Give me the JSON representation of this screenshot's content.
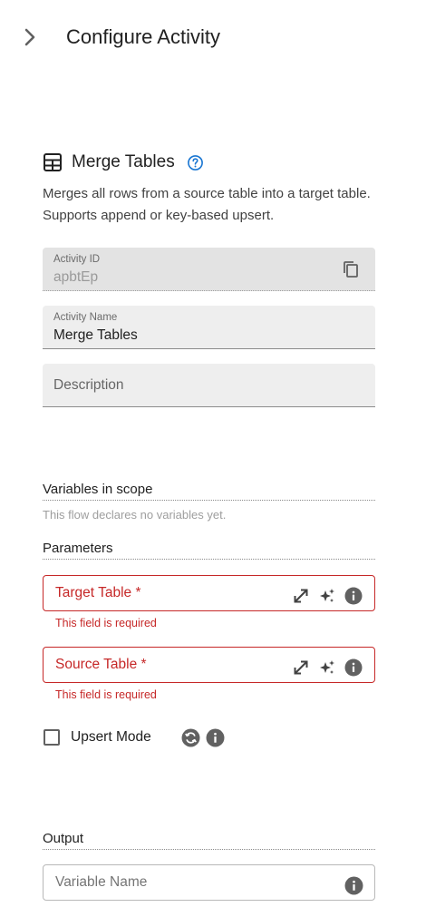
{
  "header": {
    "title": "Configure Activity"
  },
  "activity": {
    "title": "Merge Tables",
    "description": "Merges all rows from a source table into a target table. Supports append or key-based upsert."
  },
  "fields": {
    "activity_id": {
      "label": "Activity ID",
      "value": "apbtEp"
    },
    "activity_name": {
      "label": "Activity Name",
      "value": "Merge Tables"
    },
    "description": {
      "placeholder": "Description"
    }
  },
  "variables": {
    "title": "Variables in scope",
    "empty_note": "This flow declares no variables yet."
  },
  "parameters": {
    "title": "Parameters",
    "target_table": {
      "label": "Target Table *",
      "error": "This field is required"
    },
    "source_table": {
      "label": "Source Table *",
      "error": "This field is required"
    },
    "upsert_mode": {
      "label": "Upsert Mode",
      "checked": false
    }
  },
  "output": {
    "title": "Output",
    "variable_name": {
      "placeholder": "Variable Name"
    }
  },
  "colors": {
    "error": "#c62828",
    "accent": "#1976d2",
    "field_bg": "#eeeeee",
    "icon_gray": "#616161"
  },
  "icons": [
    "chevron-right-icon",
    "table-grid-icon",
    "help-circle-icon",
    "copy-icon",
    "expand-icon",
    "sparkle-icon",
    "info-icon",
    "sync-icon"
  ]
}
